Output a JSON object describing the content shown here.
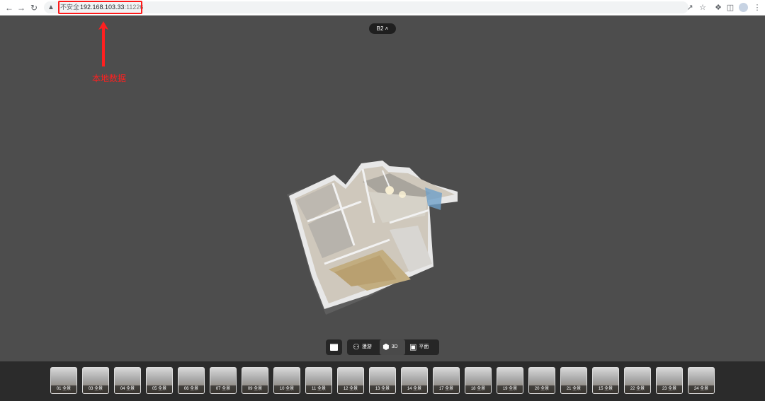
{
  "browser": {
    "security_label": "不安全",
    "url_host": "192.168.103.33",
    "url_port": ":11226"
  },
  "annotation": {
    "text": "本地数据",
    "color": "#ff2020"
  },
  "viewer": {
    "floor_label": "B2",
    "modes": [
      {
        "label": "漫游",
        "icon": "walk-icon"
      },
      {
        "label": "3D",
        "icon": "cube-icon",
        "active": true
      },
      {
        "label": "平面",
        "icon": "floorplan-icon"
      }
    ],
    "thumbnails": [
      "01 全景",
      "03 全景",
      "04 全景",
      "05 全景",
      "06 全景",
      "07 全景",
      "09 全景",
      "10 全景",
      "11 全景",
      "12 全景",
      "13 全景",
      "14 全景",
      "17 全景",
      "18 全景",
      "19 全景",
      "20 全景",
      "21 全景",
      "15 全景",
      "22 全景",
      "23 全景",
      "24 全景"
    ]
  }
}
